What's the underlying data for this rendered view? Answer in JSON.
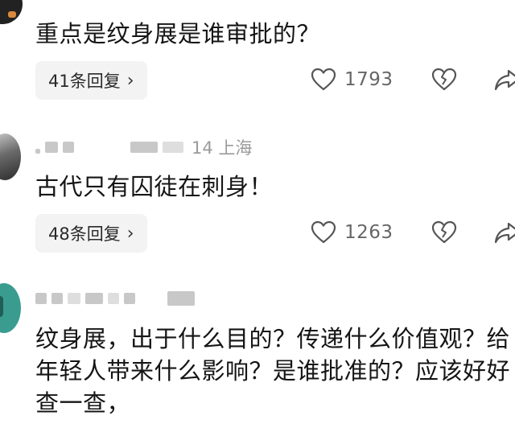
{
  "comments": [
    {
      "text": "重点是纹身展是谁审批的？",
      "reply_label": "41条回复",
      "likes": "1793"
    },
    {
      "meta_text": "14  上海",
      "text": "古代只有囚徒在刺身！",
      "reply_label": "48条回复",
      "likes": "1263"
    },
    {
      "text": "纹身展，出于什么目的？传递什么价值观？给年轻人带来什么影响？是谁批准的？应该好好查一查，"
    }
  ],
  "icons": {
    "like": "heart-icon",
    "dislike": "broken-heart-icon",
    "share": "share-arrow-icon",
    "reply_more": "chevron-right-icon"
  }
}
